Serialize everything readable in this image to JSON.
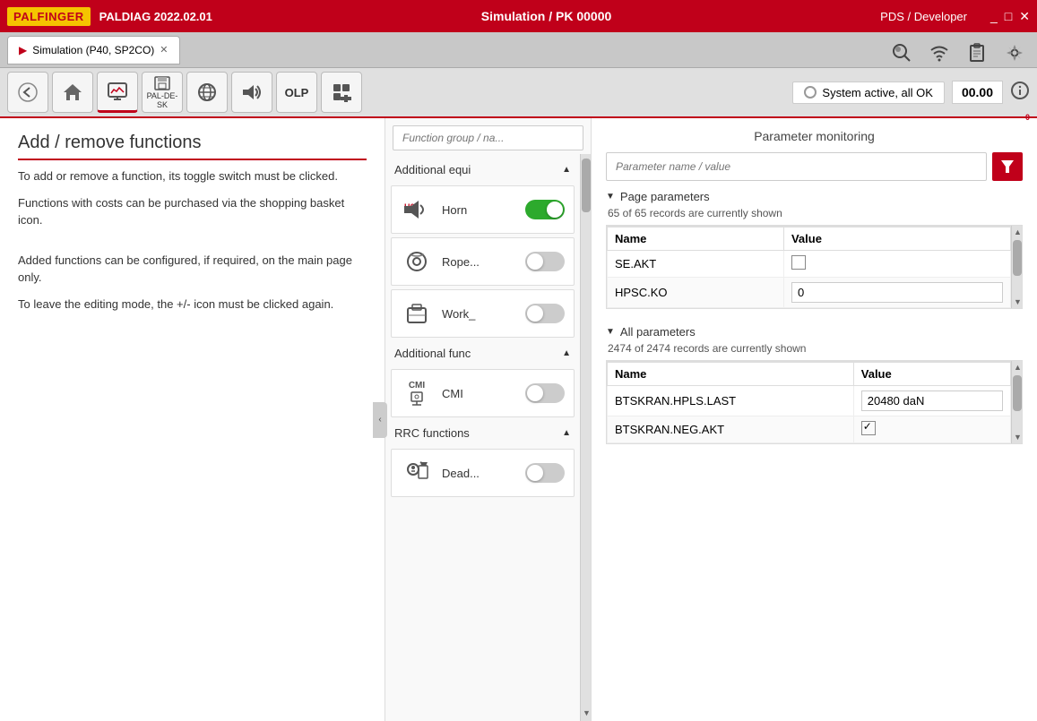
{
  "titlebar": {
    "logo": "PALFINGER",
    "app": "PALDIAG 2022.02.01",
    "center": "Simulation / PK 00000",
    "right": "PDS / Developer",
    "controls": [
      "_",
      "□",
      "✕"
    ]
  },
  "tabs": [
    {
      "label": "Simulation (P40, SP2CO)",
      "active": true
    }
  ],
  "topicons": [
    "search",
    "wifi",
    "clipboard",
    "gear"
  ],
  "toolbar": {
    "buttons": [
      {
        "icon": "◀",
        "name": "back"
      },
      {
        "icon": "⌂",
        "name": "home"
      },
      {
        "icon": "📊",
        "name": "monitor"
      },
      {
        "icon": "💾",
        "name": "save",
        "sublabel": "PAL-DE-SK"
      },
      {
        "icon": "🌐",
        "name": "global"
      },
      {
        "icon": "🔔",
        "name": "horn"
      },
      {
        "olp": true,
        "name": "olp"
      },
      {
        "icon": "⊞",
        "name": "add"
      }
    ],
    "status": "System active, all OK",
    "time": "00.00",
    "info_badge": "0"
  },
  "left_panel": {
    "title": "Add / remove functions",
    "desc1": "To add or remove a function, its toggle switch must be clicked.",
    "desc2": "Functions with costs can be purchased via the shopping basket icon.",
    "desc3": "Added functions can be configured, if required, on the main page only.",
    "desc4": "To leave the editing mode, the +/- icon must be clicked again."
  },
  "mid_panel": {
    "search_placeholder": "Function group / na...",
    "sections": [
      {
        "label": "Additional equi",
        "expanded": true,
        "items": [
          {
            "icon": "🎺",
            "name": "Horn",
            "icon_label": "H6",
            "toggled": true
          },
          {
            "icon": "🔧",
            "name": "Rope...",
            "toggled": false
          },
          {
            "icon": "🔩",
            "name": "Work_",
            "toggled": false
          }
        ]
      },
      {
        "label": "Additional func",
        "expanded": true,
        "items": [
          {
            "icon": "CMI",
            "name": "CMI",
            "toggled": false
          }
        ]
      },
      {
        "label": "RRC functions",
        "expanded": true,
        "items": [
          {
            "icon": "💀",
            "name": "Dead...",
            "toggled": false
          }
        ]
      }
    ]
  },
  "right_panel": {
    "title": "Parameter monitoring",
    "search_placeholder": "Parameter name / value",
    "page_params": {
      "label": "Page parameters",
      "count_text": "65 of 65 records are currently shown",
      "columns": [
        "Name",
        "Value"
      ],
      "rows": [
        {
          "name": "SE.AKT",
          "value": "",
          "type": "checkbox",
          "checked": false
        },
        {
          "name": "HPSC.KO",
          "value": "0",
          "type": "text"
        }
      ]
    },
    "all_params": {
      "label": "All parameters",
      "count_text": "2474 of 2474 records are currently shown",
      "columns": [
        "Name",
        "Value"
      ],
      "rows": [
        {
          "name": "BTSKRAN.HPLS.LAST",
          "value": "20480 daN",
          "type": "text"
        },
        {
          "name": "BTSKRAN.NEG.AKT",
          "value": "",
          "type": "checkbox",
          "checked": true
        }
      ]
    }
  }
}
